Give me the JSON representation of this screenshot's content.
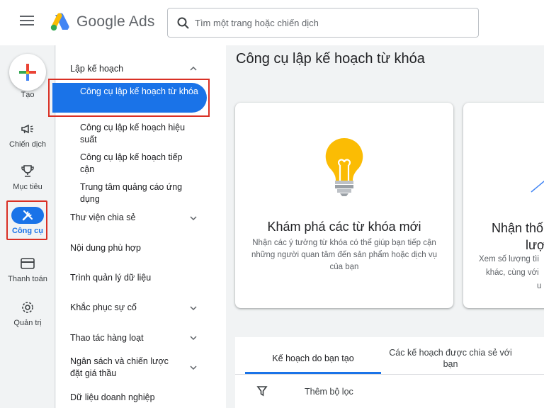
{
  "header": {
    "brand": "Google Ads",
    "search_placeholder": "Tìm một trang hoặc chiến dịch"
  },
  "rail": {
    "create": "Tạo",
    "campaigns": "Chiến dịch",
    "goals": "Mục tiêu",
    "tools": "Công cụ",
    "billing": "Thanh toán",
    "admin": "Quản trị"
  },
  "nav": {
    "planning": "Lập kế hoạch",
    "planning_items": [
      "Công cụ lập kế hoạch từ khóa",
      "Công cụ lập kế hoạch hiệu suất",
      "Công cụ lập kế hoạch tiếp cận",
      "Trung tâm quảng cáo ứng dụng"
    ],
    "shared_library": "Thư viện chia sẻ",
    "content_suitability": "Nội dung phù hợp",
    "data_manager": "Trình quản lý dữ liệu",
    "troubleshooting": "Khắc phục sự cố",
    "bulk_actions": "Thao tác hàng loạt",
    "budgets_bidding": "Ngân sách và chiến lược đặt giá thầu",
    "business_data": "Dữ liệu doanh nghiệp"
  },
  "main": {
    "title": "Công cụ lập kế hoạch từ khóa",
    "card1": {
      "title": "Khám phá các từ khóa mới",
      "desc": "Nhận các ý tưởng từ khóa có thể giúp bạn tiếp cận những người quan tâm đến sản phẩm hoặc dịch vụ của bạn"
    },
    "card2": {
      "title_line1": "Nhận thố",
      "title_line2": "lượ",
      "desc_line1": "Xem số lượng tìi",
      "desc_line2": "khác, cùng với",
      "desc_line3": "u"
    },
    "tabs": {
      "created": "Kế hoạch do bạn tạo",
      "shared": "Các kế hoạch được chia sẻ với bạn"
    },
    "filter": "Thêm bộ lọc"
  },
  "colors": {
    "accent": "#1a73e8",
    "highlight": "#d93025",
    "bulb": "#fbbc04"
  }
}
